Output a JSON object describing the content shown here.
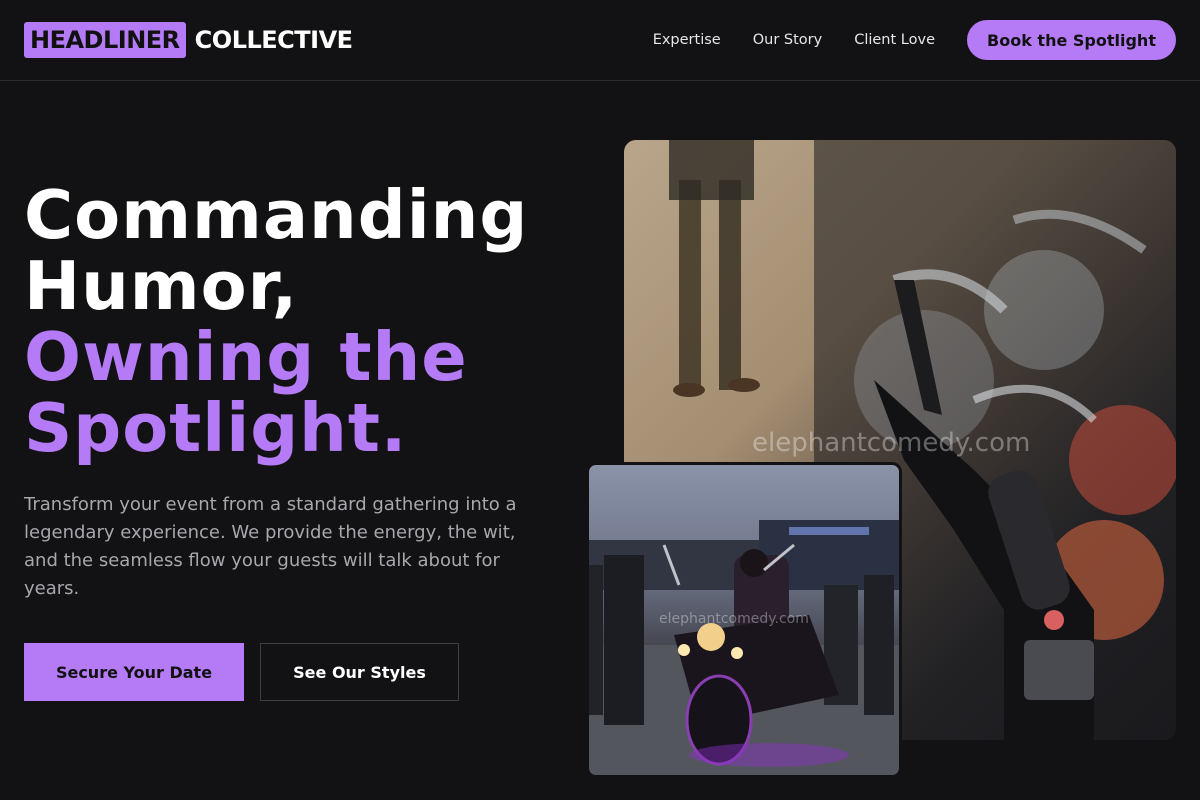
{
  "brand": {
    "logo_box": "HEADLINER",
    "logo_rest": "COLLECTIVE",
    "accent_color": "#b57bf7"
  },
  "nav": {
    "links": [
      "Expertise",
      "Our Story",
      "Client Love"
    ],
    "cta": "Book the Spotlight"
  },
  "hero": {
    "title_lines": [
      "Commanding",
      "Humor,"
    ],
    "accent_lines": [
      "Owning the",
      "Spotlight."
    ],
    "description": "Transform your event from a standard gathering into a legendary experience. We provide the energy, the wit, and the seamless flow your guests will talk about for years.",
    "primary_button": "Secure Your Date",
    "secondary_button": "See Our Styles"
  },
  "images": {
    "large_alt": "Rows of parked motorcycles with a person standing in the background",
    "small_alt": "Rider on a motorcycle with purple underglow at a street event",
    "watermark": "elephantcomedy.com"
  }
}
